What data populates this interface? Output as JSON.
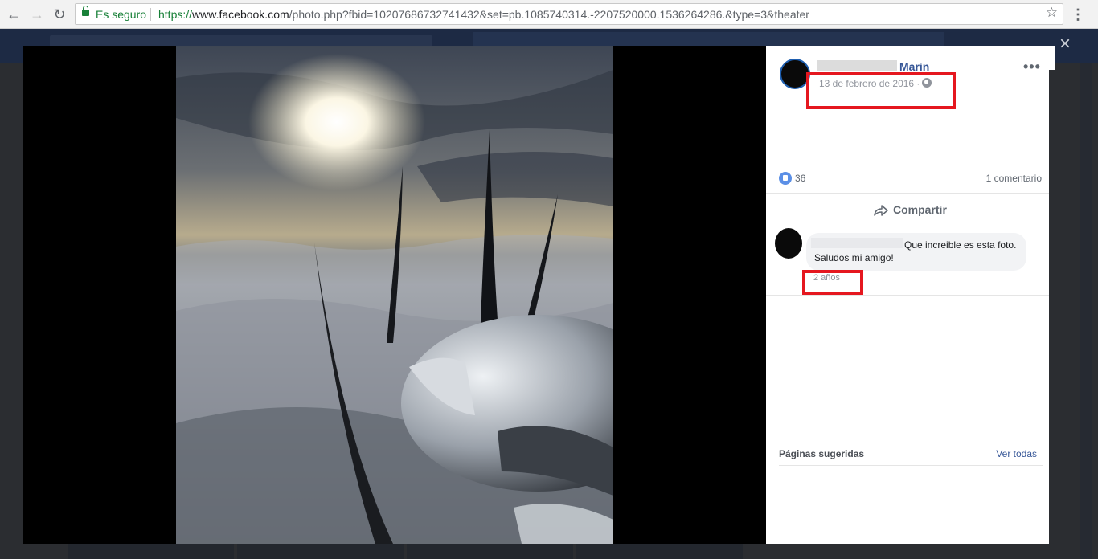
{
  "browser": {
    "secure_label": "Es seguro",
    "url_scheme": "https://",
    "url_host": "www.facebook.com",
    "url_rest": "/photo.php?fbid=10207686732741432&set=pb.1085740314.-2207520000.1536264286.&type=3&theater",
    "icons": [
      "back-icon",
      "forward-icon",
      "reload-icon",
      "lock-icon",
      "star-icon",
      "kebab-menu-icon"
    ]
  },
  "theater": {
    "close_icon": "×"
  },
  "post": {
    "author_name": "Marin",
    "date": "13 de febrero de 2016 ·",
    "likes": "36",
    "comments": "1 comentario",
    "share_label": "Compartir",
    "more_icon": "•••"
  },
  "comment": {
    "text": "Que increible es esta foto. Saludos mi amigo!",
    "time": "2 años"
  },
  "suggested": {
    "title": "Páginas sugeridas",
    "see_all": "Ver todas"
  },
  "colors": {
    "highlight": "#e5171f",
    "link": "#385898",
    "secure": "#188038"
  }
}
